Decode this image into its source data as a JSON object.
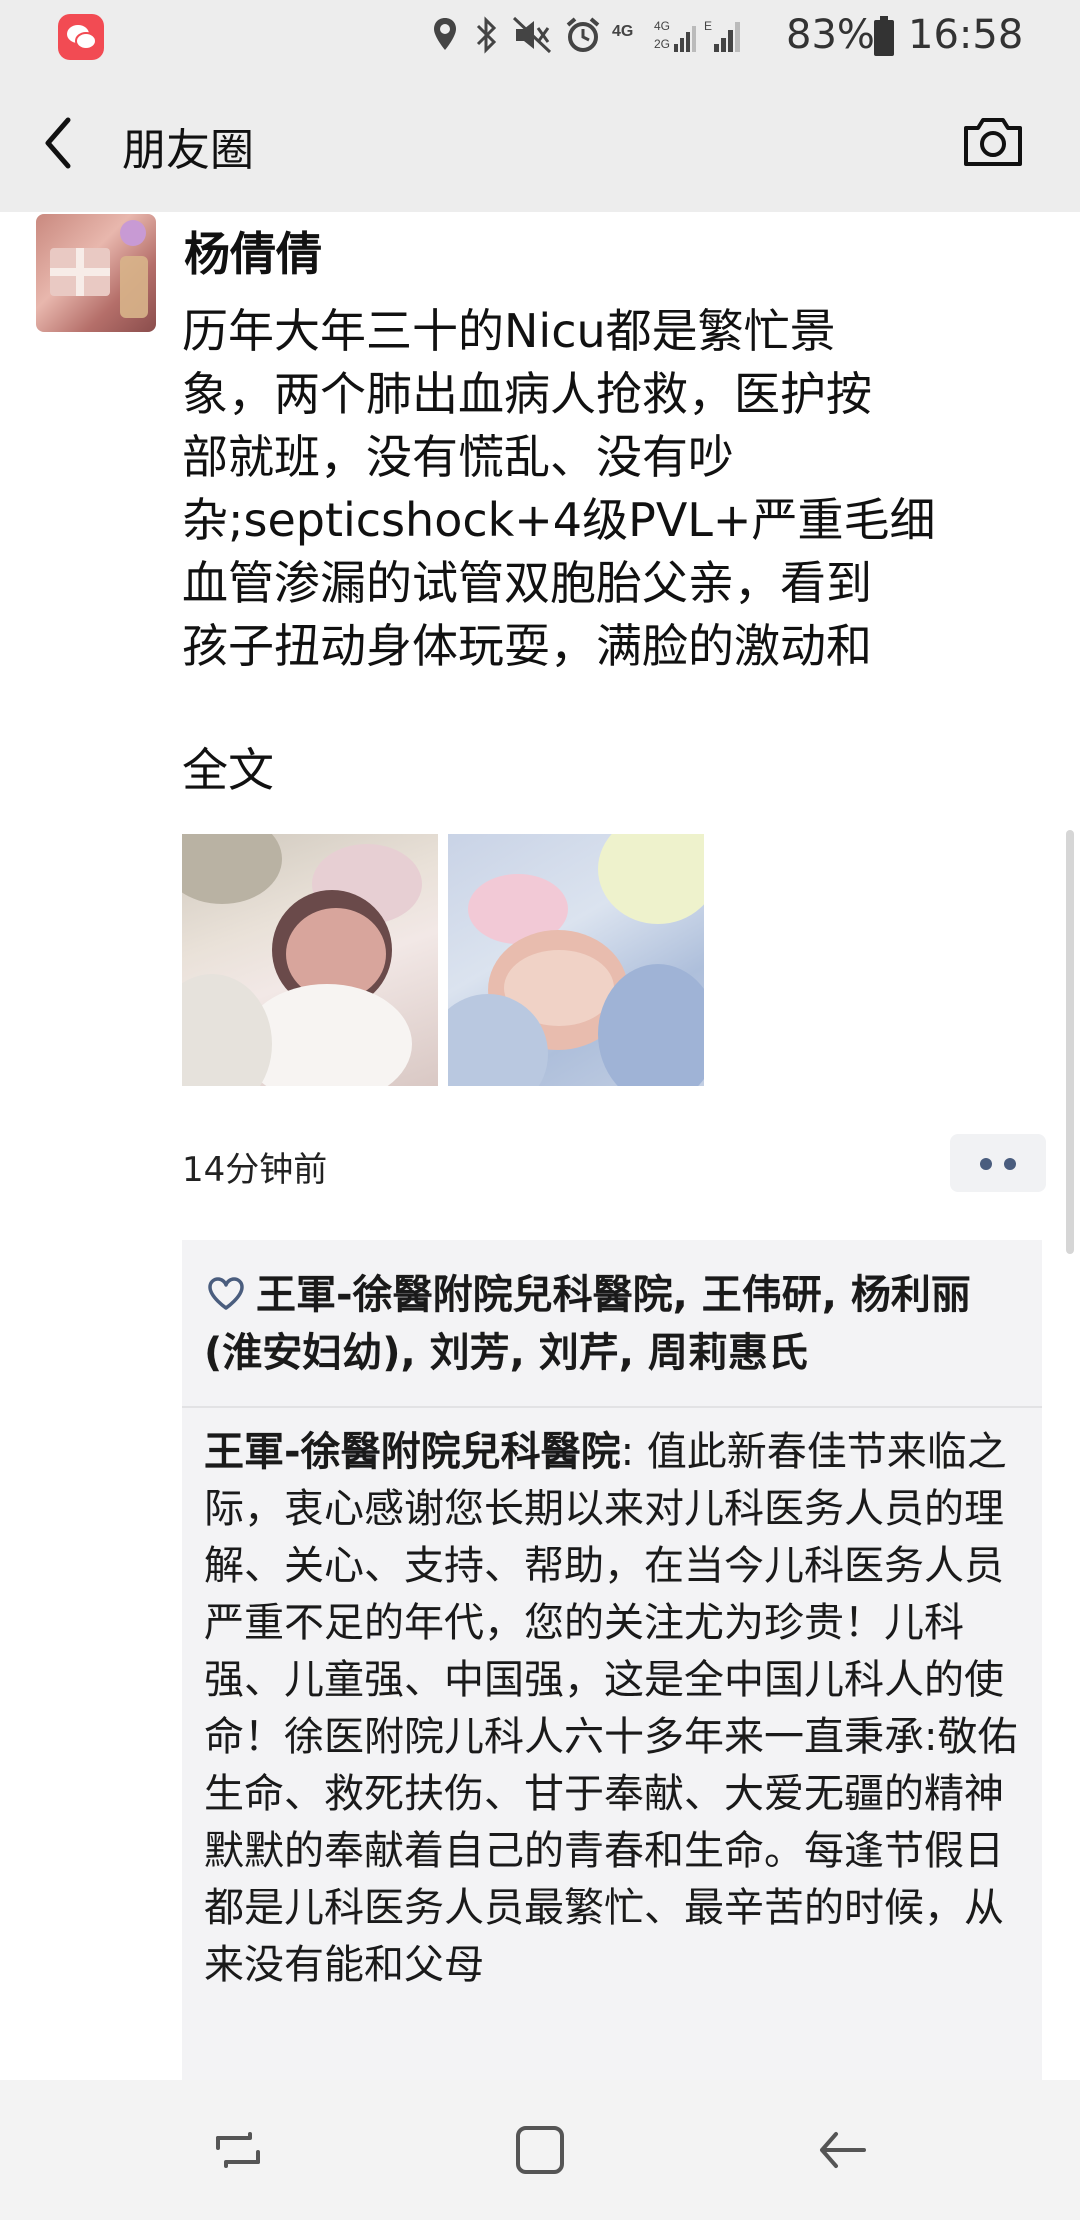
{
  "status_bar": {
    "battery_percent": "83%",
    "time": "16:58",
    "network_labels": [
      "4G",
      "4G",
      "2G",
      "E"
    ],
    "icons": [
      "notification-app-icon",
      "location-icon",
      "bluetooth-icon",
      "mute-icon",
      "alarm-icon",
      "signal-icon",
      "battery-icon"
    ]
  },
  "header": {
    "title": "朋友圈",
    "back_icon": "chevron-left-icon",
    "camera_icon": "camera-icon"
  },
  "post": {
    "author": "杨倩倩",
    "text": "历年大年三十的Nicu都是繁忙景\n象，两个肺出血病人抢救，医护按\n部就班，没有慌乱、没有吵\n杂;septicshock+4级PVL+严重毛细\n血管渗漏的试管双胞胎父亲，看到\n孩子扭动身体玩耍，满脸的激动和",
    "expand_label": "全文",
    "time": "14分钟前",
    "photos": [
      "photo-infant-1",
      "photo-infant-2"
    ],
    "likes": "王軍-徐醫附院兒科醫院, 王伟研, 杨利丽(淮安妇幼), 刘芳, 刘芹, 周莉惠氏",
    "comment": {
      "author": "王軍-徐醫附院兒科醫院",
      "separator": ": ",
      "text": "值此新春佳节来临之际，衷心感谢您长期以来对儿科医务人员的理解、关心、支持、帮助，在当今儿科医务人员严重不足的年代，您的关注尤为珍贵！儿科强、儿童强、中国强，这是全中国儿科人的使命！徐医附院儿科人六十多年来一直秉承:敬佑生命、救死扶伤、甘于奉献、大爱无疆的精神默默的奉献着自己的青春和生命。每逢节假日都是儿科医务人员最繁忙、最辛苦的时候，从来没有能和父母"
    }
  },
  "nav_bar": {
    "icons": [
      "recent-apps-icon",
      "home-icon",
      "back-nav-icon"
    ]
  },
  "colors": {
    "header_bg": "#ededed",
    "link_blue": "#4a5d7e",
    "interaction_bg": "#f3f3f5"
  }
}
